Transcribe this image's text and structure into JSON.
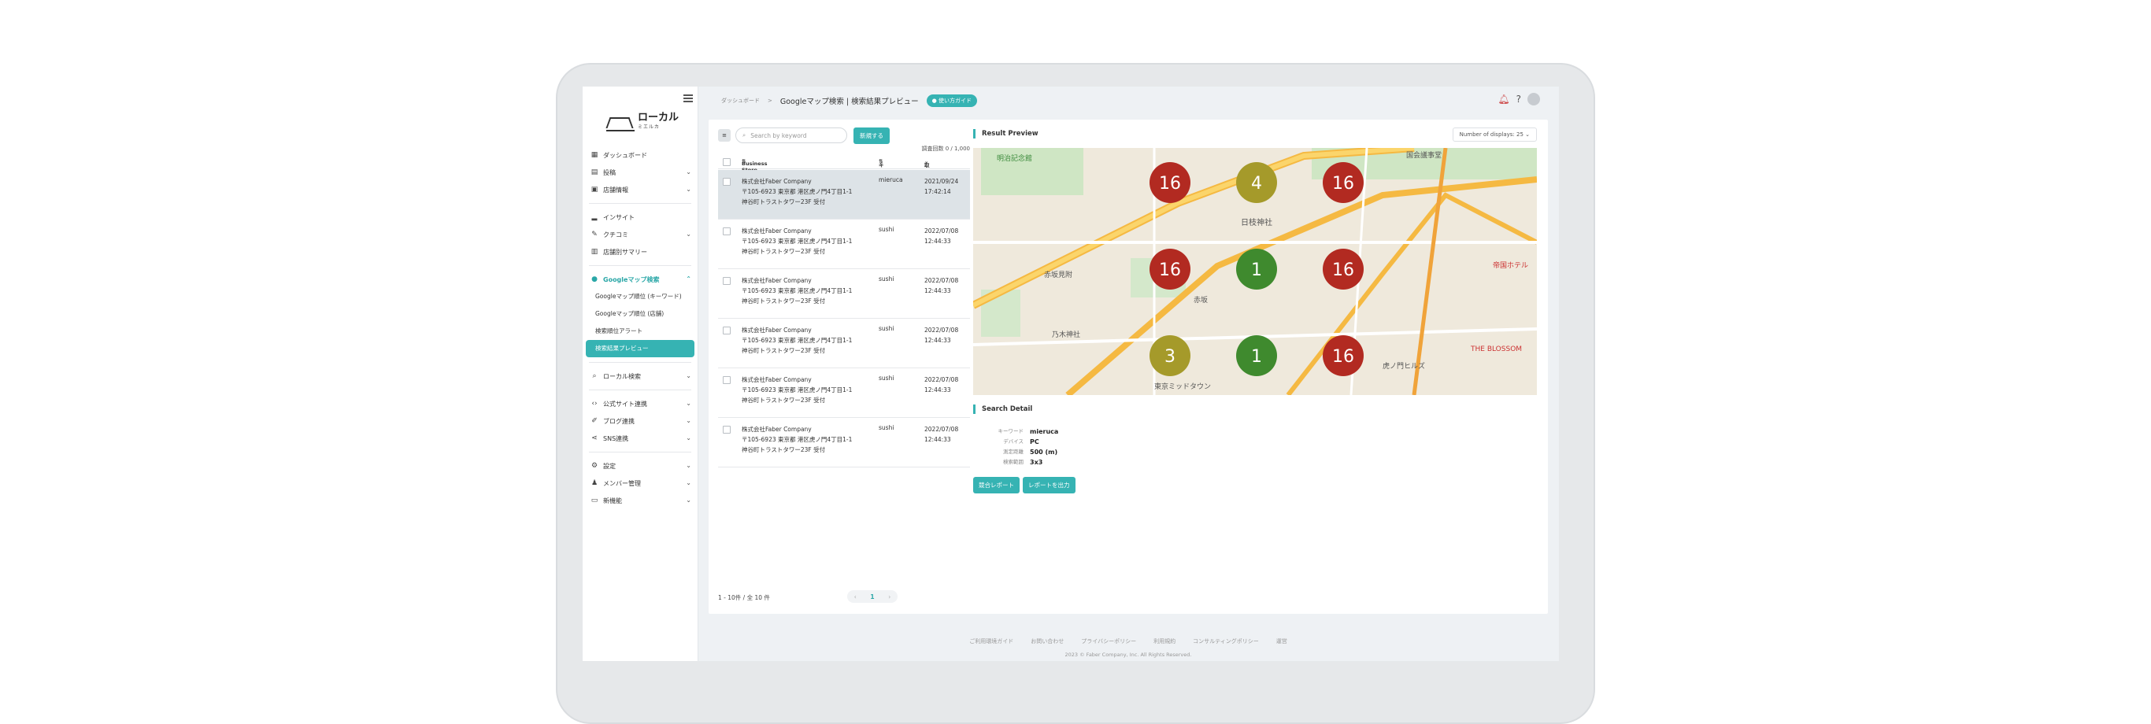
{
  "sidebar": {
    "logo_text": "ローカル",
    "logo_sub": "ミエルカ",
    "items": [
      {
        "label": "ダッシュボード",
        "icon": "dashboard-icon",
        "chev": false
      },
      {
        "label": "投稿",
        "icon": "post-icon",
        "chev": true
      },
      {
        "label": "店舗情報",
        "icon": "store-icon",
        "chev": true
      }
    ],
    "items2": [
      {
        "label": "インサイト",
        "icon": "chart-icon",
        "chev": false
      },
      {
        "label": "クチコミ",
        "icon": "review-icon",
        "chev": true
      },
      {
        "label": "店舗別サマリー",
        "icon": "summary-icon",
        "chev": false
      }
    ],
    "maps_parent": "Googleマップ検索",
    "maps_sub": [
      "Googleマップ順位 (キーワード)",
      "Googleマップ順位 (店舗)",
      "検索順位アラート",
      "検索結果プレビュー"
    ],
    "items3": [
      {
        "label": "ローカル検索",
        "icon": "local-search-icon",
        "chev": true
      }
    ],
    "items4": [
      {
        "label": "公式サイト連携",
        "icon": "code-icon",
        "chev": true
      },
      {
        "label": "ブログ連携",
        "icon": "pen-icon",
        "chev": true
      },
      {
        "label": "SNS連携",
        "icon": "share-icon",
        "chev": true
      }
    ],
    "items5": [
      {
        "label": "設定",
        "icon": "gear-icon",
        "chev": true
      },
      {
        "label": "メンバー管理",
        "icon": "member-icon",
        "chev": true
      },
      {
        "label": "新機能",
        "icon": "new-icon",
        "chev": true
      }
    ]
  },
  "header": {
    "crumb_home": "ダッシュボード",
    "crumb_sep": ">",
    "title": "Googleマップ検索 | 検索結果プレビュー",
    "guide": "使い方ガイド"
  },
  "list": {
    "search_placeholder": "Search by keyword",
    "new_button": "新規する",
    "count": "調査回数 0 / 1,000",
    "col_business": "Business Store",
    "col_keyword": "キーワード",
    "col_date": "取得日",
    "rows": [
      {
        "name": "株式会社Faber Company",
        "addr1": "〒105-6923 東京都 港区虎ノ門4丁目1-1",
        "addr2": "神谷町トラストタワー23F 受付",
        "kw": "mieruca",
        "date": "2021/09/24",
        "time": "17:42:14"
      },
      {
        "name": "株式会社Faber Company",
        "addr1": "〒105-6923 東京都 港区虎ノ門4丁目1-1",
        "addr2": "神谷町トラストタワー23F 受付",
        "kw": "sushi",
        "date": "2022/07/08",
        "time": "12:44:33"
      },
      {
        "name": "株式会社Faber Company",
        "addr1": "〒105-6923 東京都 港区虎ノ門4丁目1-1",
        "addr2": "神谷町トラストタワー23F 受付",
        "kw": "sushi",
        "date": "2022/07/08",
        "time": "12:44:33"
      },
      {
        "name": "株式会社Faber Company",
        "addr1": "〒105-6923 東京都 港区虎ノ門4丁目1-1",
        "addr2": "神谷町トラストタワー23F 受付",
        "kw": "sushi",
        "date": "2022/07/08",
        "time": "12:44:33"
      },
      {
        "name": "株式会社Faber Company",
        "addr1": "〒105-6923 東京都 港区虎ノ門4丁目1-1",
        "addr2": "神谷町トラストタワー23F 受付",
        "kw": "sushi",
        "date": "2022/07/08",
        "time": "12:44:33"
      },
      {
        "name": "株式会社Faber Company",
        "addr1": "〒105-6923 東京都 港区虎ノ門4丁目1-1",
        "addr2": "神谷町トラストタワー23F 受付",
        "kw": "sushi",
        "date": "2022/07/08",
        "time": "12:44:33"
      }
    ],
    "pager_info": "1 - 10件 / 全 10 件",
    "page": "1",
    "prev": "‹",
    "next": "›"
  },
  "preview": {
    "title": "Result Preview",
    "display_label": "Number of displays: 25",
    "markers": [
      {
        "rank": "16",
        "color": "#b22a21"
      },
      {
        "rank": "4",
        "color": "#a59a2a"
      },
      {
        "rank": "16",
        "color": "#b22a21"
      },
      {
        "rank": "16",
        "color": "#b22a21"
      },
      {
        "rank": "1",
        "color": "#3f8a2e"
      },
      {
        "rank": "16",
        "color": "#b22a21"
      },
      {
        "rank": "3",
        "color": "#a59a2a"
      },
      {
        "rank": "1",
        "color": "#3f8a2e"
      },
      {
        "rank": "16",
        "color": "#b22a21"
      }
    ],
    "map_labels": [
      "明治記念館",
      "日枝神社",
      "赤坂",
      "乃木神社",
      "東京ミッドタウン",
      "帝国ホテル",
      "THE BLOSSOM",
      "虎ノ門ヒルズ",
      "赤坂見附",
      "国会議事堂"
    ]
  },
  "detail": {
    "title": "Search Detail",
    "fields": [
      {
        "label": "キーワード",
        "value": "mieruca"
      },
      {
        "label": "デバイス",
        "value": "PC"
      },
      {
        "label": "測定距離",
        "value": "500 (m)"
      },
      {
        "label": "検索範囲",
        "value": "3x3"
      }
    ],
    "btn_report": "競合レポート",
    "btn_export": "レポートを出力"
  },
  "footer": {
    "links": [
      "ご利用環境ガイド",
      "お問い合わせ",
      "プライバシーポリシー",
      "利用規約",
      "コンサルティングポリシー",
      "運営"
    ],
    "copyright": "2023 © Faber Company, Inc. All Rights Reserved."
  }
}
